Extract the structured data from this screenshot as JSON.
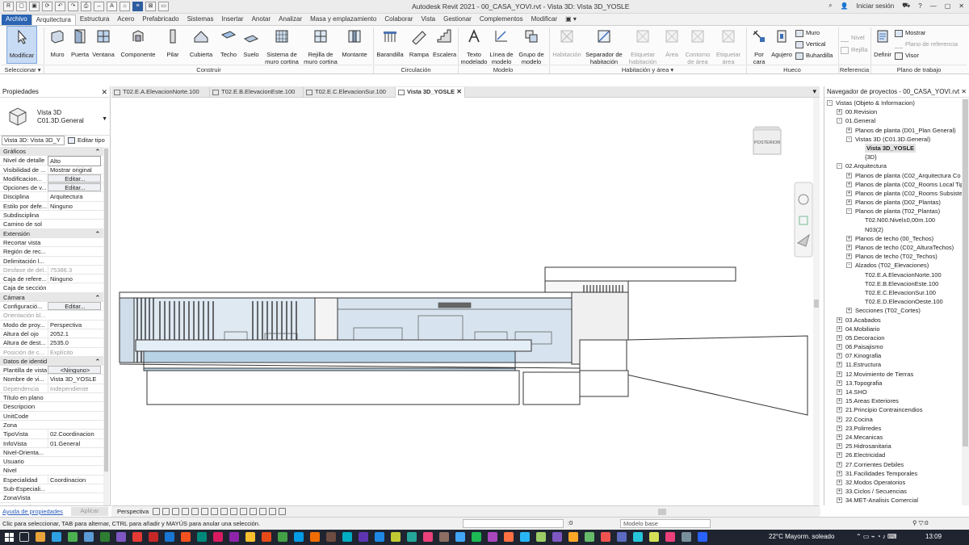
{
  "app": {
    "title": "Autodesk Revit 2021 - 00_CASA_YOVI.rvt - Vista 3D: Vista 3D_YOSLE",
    "signin": "Iniciar sesión"
  },
  "ribbon_tabs": [
    "Archivo",
    "Arquitectura",
    "Estructura",
    "Acero",
    "Prefabricado",
    "Sistemas",
    "Insertar",
    "Anotar",
    "Analizar",
    "Masa y emplazamiento",
    "Colaborar",
    "Vista",
    "Gestionar",
    "Complementos",
    "Modificar"
  ],
  "ribbon": {
    "modificar": "Modificar",
    "seleccionar": "Seleccionar ▾",
    "construir": [
      "Muro",
      "Puerta",
      "Ventana",
      "Componente",
      "Pilar",
      "Cubierta",
      "Techo",
      "Suelo",
      "Sistema de muro cortina",
      "Rejilla de muro cortina",
      "Montante"
    ],
    "construir_label": "Construir",
    "circulacion": [
      "Barandilla",
      "Rampa",
      "Escalera"
    ],
    "circulacion_label": "Circulación",
    "modelo": [
      "Texto modelado",
      "Línea de modelo",
      "Grupo de modelo"
    ],
    "modelo_label": "Modelo",
    "habitacion": [
      "Habitación",
      "Separador de habitación",
      "Etiquetar habitación",
      "Área",
      "Contorno de área",
      "Etiquetar área"
    ],
    "habitacion_label": "Habitación y área ▾",
    "hueco": [
      "Por cara",
      "Agujero",
      "Muro",
      "Vertical",
      "Buhardilla"
    ],
    "hueco_label": "Hueco",
    "referencia": [
      "Nivel",
      "Rejilla"
    ],
    "referencia_label": "Referencia",
    "plano": [
      "Definir",
      "Mostrar",
      "Plano de referencia",
      "Visor"
    ],
    "plano_label": "Plano de trabajo"
  },
  "properties": {
    "title": "Propiedades",
    "type_name": [
      "Vista 3D",
      "C01.3D.General"
    ],
    "filter": "Vista 3D: Vista 3D_Y",
    "edit_type": "Editar tipo",
    "help": "Ayuda de propiedades",
    "apply": "Aplicar",
    "rows": [
      {
        "cat": "Gráficos"
      },
      {
        "k": "Nivel de detalle",
        "v": "Alto",
        "box": true
      },
      {
        "k": "Visibilidad de ...",
        "v": "Mostrar original"
      },
      {
        "k": "Modificacion...",
        "v": "Editar...",
        "btn": true
      },
      {
        "k": "Opciones de v...",
        "v": "Editar...",
        "btn": true
      },
      {
        "k": "Disciplina",
        "v": "Arquitectura"
      },
      {
        "k": "Estilo por defe...",
        "v": "Ninguno"
      },
      {
        "k": "Subdisciplina",
        "v": ""
      },
      {
        "k": "Camino de sol",
        "v": "",
        "cb": true
      },
      {
        "cat": "Extensión"
      },
      {
        "k": "Recortar vista",
        "v": "",
        "cb": true
      },
      {
        "k": "Región de rec...",
        "v": "",
        "cb": true
      },
      {
        "k": "Delimitación l...",
        "v": "",
        "cb": true
      },
      {
        "k": "Desfase de del...",
        "v": "75386.3",
        "dim": true
      },
      {
        "k": "Caja de refere...",
        "v": "Ninguno"
      },
      {
        "k": "Caja de sección",
        "v": "",
        "cb": true
      },
      {
        "cat": "Cámara"
      },
      {
        "k": "Configuració...",
        "v": "Editar...",
        "btn": true
      },
      {
        "k": "Orientación bl...",
        "v": "",
        "cb": true,
        "dim": true
      },
      {
        "k": "Modo de proy...",
        "v": "Perspectiva"
      },
      {
        "k": "Altura del ojo",
        "v": "2052.1"
      },
      {
        "k": "Altura de dest...",
        "v": "2535.0"
      },
      {
        "k": "Posición de c...",
        "v": "Explícito",
        "dim": true
      },
      {
        "cat": "Datos de identidad"
      },
      {
        "k": "Plantilla de vista",
        "v": "<Ninguno>",
        "btn": true
      },
      {
        "k": "Nombre de vi...",
        "v": "Vista 3D_YOSLE"
      },
      {
        "k": "Dependencia",
        "v": "Independiente",
        "dim": true
      },
      {
        "k": "Título en plano",
        "v": ""
      },
      {
        "k": "Descripcion",
        "v": ""
      },
      {
        "k": "UnitCode",
        "v": ""
      },
      {
        "k": "Zona",
        "v": ""
      },
      {
        "k": "TipoVista",
        "v": "02.Coordinacion"
      },
      {
        "k": "InfoVista",
        "v": "01.General"
      },
      {
        "k": "Nivel-Orienta...",
        "v": ""
      },
      {
        "k": "Usuario",
        "v": ""
      },
      {
        "k": "Nivel",
        "v": ""
      },
      {
        "k": "Especialidad",
        "v": "Coordinacion"
      },
      {
        "k": "Sub-Especiali...",
        "v": ""
      },
      {
        "k": "ZonaVista",
        "v": ""
      },
      {
        "k": "VariantePlaca",
        "v": ""
      }
    ]
  },
  "doc_tabs": [
    "T02.E.A.ElevacionNorte.100",
    "T02.E.B.ElevacionEste.100",
    "T02.E.C.ElevacionSur.100",
    "Vista 3D_YOSLE"
  ],
  "viewcube_label": "POSTERIOR",
  "view_bar": {
    "mode": "Perspectiva"
  },
  "browser": {
    "title": "Navegador de proyectos - 00_CASA_YOVI.rvt",
    "nodes": [
      {
        "t": "Vistas (Objeto & Informacion)",
        "d": 0,
        "e": "-"
      },
      {
        "t": "00.Revision",
        "d": 1,
        "e": "+"
      },
      {
        "t": "01.General",
        "d": 1,
        "e": "-"
      },
      {
        "t": "Planos de planta (D01_Plan General)",
        "d": 2,
        "e": "+"
      },
      {
        "t": "Vistas 3D (C01.3D.General)",
        "d": 2,
        "e": "-"
      },
      {
        "t": "Vista 3D_YOSLE",
        "d": 3,
        "sel": true
      },
      {
        "t": "{3D}",
        "d": 3
      },
      {
        "t": "02.Arquitectura",
        "d": 1,
        "e": "-"
      },
      {
        "t": "Planos de planta (C02_Arquitectura Co",
        "d": 2,
        "e": "+"
      },
      {
        "t": "Planos de planta (C02_Rooms Local Tip",
        "d": 2,
        "e": "+"
      },
      {
        "t": "Planos de planta (C02_Rooms Subsiste",
        "d": 2,
        "e": "+"
      },
      {
        "t": "Planos de planta (D02_Plantas)",
        "d": 2,
        "e": "+"
      },
      {
        "t": "Planos de planta (T02_Plantas)",
        "d": 2,
        "e": "-"
      },
      {
        "t": "T02.N00.Nivel±0,00m.100",
        "d": 3
      },
      {
        "t": "N03(2)",
        "d": 3
      },
      {
        "t": "Planos de techo (00_Techos)",
        "d": 2,
        "e": "+"
      },
      {
        "t": "Planos de techo (C02_AlturaTechos)",
        "d": 2,
        "e": "+"
      },
      {
        "t": "Planos de techo (T02_Techos)",
        "d": 2,
        "e": "+"
      },
      {
        "t": "Alzados (T02_Elevaciones)",
        "d": 2,
        "e": "-"
      },
      {
        "t": "T02.E.A.ElevacionNorte.100",
        "d": 3
      },
      {
        "t": "T02.E.B.ElevacionEste.100",
        "d": 3
      },
      {
        "t": "T02.E.C.ElevacionSur.100",
        "d": 3
      },
      {
        "t": "T02.E.D.ElevacionOeste.100",
        "d": 3
      },
      {
        "t": "Secciones (T02_Cortes)",
        "d": 2,
        "e": "+"
      },
      {
        "t": "03.Acabados",
        "d": 1,
        "e": "+"
      },
      {
        "t": "04.Mobiliario",
        "d": 1,
        "e": "+"
      },
      {
        "t": "05.Decoracion",
        "d": 1,
        "e": "+"
      },
      {
        "t": "06.Paisajismo",
        "d": 1,
        "e": "+"
      },
      {
        "t": "07.Kinografia",
        "d": 1,
        "e": "+"
      },
      {
        "t": "11.Estructura",
        "d": 1,
        "e": "+"
      },
      {
        "t": "12.Movimiento de Tierras",
        "d": 1,
        "e": "+"
      },
      {
        "t": "13.Topografia",
        "d": 1,
        "e": "+"
      },
      {
        "t": "14.SHO",
        "d": 1,
        "e": "+"
      },
      {
        "t": "15.Areas Exteriores",
        "d": 1,
        "e": "+"
      },
      {
        "t": "21.Principio Contraincendios",
        "d": 1,
        "e": "+"
      },
      {
        "t": "22.Cocina",
        "d": 1,
        "e": "+"
      },
      {
        "t": "23.Polirredes",
        "d": 1,
        "e": "+"
      },
      {
        "t": "24.Mecanicas",
        "d": 1,
        "e": "+"
      },
      {
        "t": "25.Hidrosanitaria",
        "d": 1,
        "e": "+"
      },
      {
        "t": "26.Electricidad",
        "d": 1,
        "e": "+"
      },
      {
        "t": "27.Corrientes Debiles",
        "d": 1,
        "e": "+"
      },
      {
        "t": "31.Facilidades Temporales",
        "d": 1,
        "e": "+"
      },
      {
        "t": "32.Modos Operatorios",
        "d": 1,
        "e": "+"
      },
      {
        "t": "33.Ciclos / Secuencias",
        "d": 1,
        "e": "+"
      },
      {
        "t": "34.MET-Analisis Comercial",
        "d": 1,
        "e": "+"
      }
    ]
  },
  "status": {
    "message": "Clic para seleccionar, TAB para alternar, CTRL para añadir y MAYÚS para anular una selección.",
    "coord": ":0",
    "model": "Modelo base"
  },
  "taskbar": {
    "weather": "22°C  Mayorm. soleado",
    "time": "13:09"
  }
}
